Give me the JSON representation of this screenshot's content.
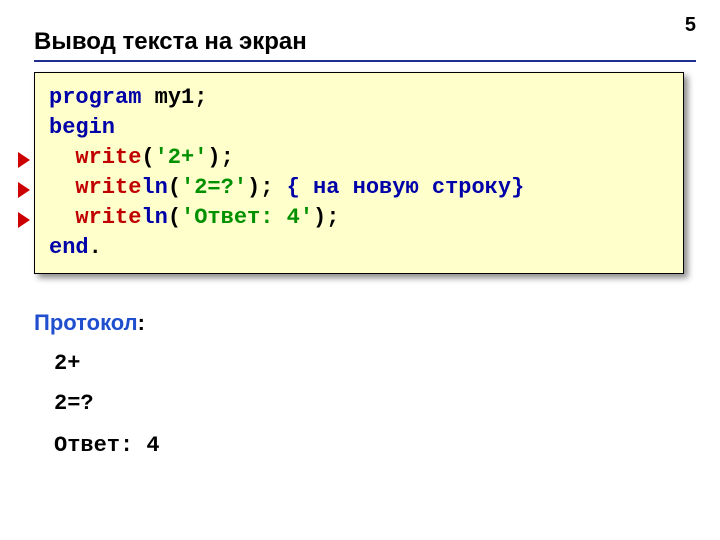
{
  "page_number": "5",
  "title": "Вывод текста на экран",
  "code": {
    "kw_program": "program",
    "prog_name": " my1",
    "semicolon": ";",
    "kw_begin": "begin",
    "write": "write",
    "ln": "ln",
    "lparen": "(",
    "rparen": ")",
    "str1": "'2+'",
    "str2": "'2=?'",
    "str3": "'Ответ: 4'",
    "comment": "{ на новую строку}",
    "kw_end": "end",
    "dot": "."
  },
  "protocol_label": "Протокол",
  "protocol_colon": ":",
  "output": {
    "l1": "2+",
    "l2": "2=?",
    "l3": "Ответ: 4"
  }
}
